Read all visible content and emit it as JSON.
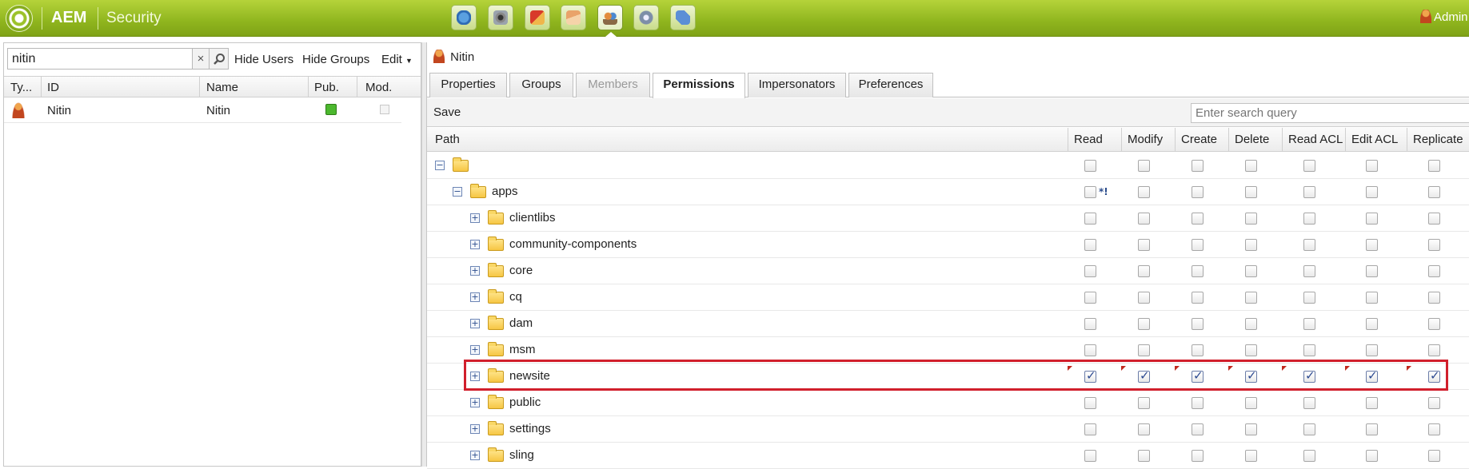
{
  "topbar": {
    "brand": "AEM",
    "section": "Security",
    "tools": [
      "websites-icon",
      "digital-assets-icon",
      "campaigns-icon",
      "inbox-icon",
      "users-icon",
      "tools-icon",
      "tagging-icon"
    ],
    "active_tool": "users-icon",
    "user": "Admin"
  },
  "left": {
    "search_value": "nitin",
    "clear": "×",
    "hide_users": "Hide Users",
    "hide_groups": "Hide Groups",
    "edit": "Edit",
    "columns": [
      "Ty...",
      "ID",
      "Name",
      "Pub.",
      "Mod."
    ],
    "rows": [
      {
        "id": "Nitin",
        "name": "Nitin",
        "published": true,
        "modified": false
      }
    ]
  },
  "right": {
    "title": "Nitin",
    "tabs": [
      {
        "label": "Properties",
        "state": "normal"
      },
      {
        "label": "Groups",
        "state": "normal"
      },
      {
        "label": "Members",
        "state": "disabled"
      },
      {
        "label": "Permissions",
        "state": "active"
      },
      {
        "label": "Impersonators",
        "state": "normal"
      },
      {
        "label": "Preferences",
        "state": "normal"
      }
    ],
    "save": "Save",
    "query_placeholder": "Enter search query",
    "columns": {
      "path": "Path",
      "read": "Read",
      "modify": "Modify",
      "create": "Create",
      "delete": "Delete",
      "read_acl": "Read ACL",
      "edit_acl": "Edit ACL",
      "replicate": "Replicate"
    },
    "rows": [
      {
        "name": "",
        "level": 0,
        "expander": "−",
        "perms": [
          false,
          false,
          false,
          false,
          false,
          false,
          false
        ]
      },
      {
        "name": "apps",
        "level": 1,
        "expander": "−",
        "perms": [
          false,
          false,
          false,
          false,
          false,
          false,
          false
        ],
        "effective_note": "*!"
      },
      {
        "name": "clientlibs",
        "level": 2,
        "expander": "+",
        "perms": [
          false,
          false,
          false,
          false,
          false,
          false,
          false
        ]
      },
      {
        "name": "community-components",
        "level": 2,
        "expander": "+",
        "perms": [
          false,
          false,
          false,
          false,
          false,
          false,
          false
        ]
      },
      {
        "name": "core",
        "level": 2,
        "expander": "+",
        "perms": [
          false,
          false,
          false,
          false,
          false,
          false,
          false
        ]
      },
      {
        "name": "cq",
        "level": 2,
        "expander": "+",
        "perms": [
          false,
          false,
          false,
          false,
          false,
          false,
          false
        ]
      },
      {
        "name": "dam",
        "level": 2,
        "expander": "+",
        "perms": [
          false,
          false,
          false,
          false,
          false,
          false,
          false
        ]
      },
      {
        "name": "msm",
        "level": 2,
        "expander": "+",
        "perms": [
          false,
          false,
          false,
          false,
          false,
          false,
          false
        ]
      },
      {
        "name": "newsite",
        "level": 2,
        "expander": "+",
        "perms": [
          true,
          true,
          true,
          true,
          true,
          true,
          true
        ],
        "dirty": true,
        "highlighted": true
      },
      {
        "name": "public",
        "level": 2,
        "expander": "+",
        "perms": [
          false,
          false,
          false,
          false,
          false,
          false,
          false
        ]
      },
      {
        "name": "settings",
        "level": 2,
        "expander": "+",
        "perms": [
          false,
          false,
          false,
          false,
          false,
          false,
          false
        ]
      },
      {
        "name": "sling",
        "level": 2,
        "expander": "+",
        "perms": [
          false,
          false,
          false,
          false,
          false,
          false,
          false
        ]
      }
    ]
  },
  "colors": {
    "topbar": "#8fb51e",
    "highlight": "#d11f2c",
    "published": "#4cb82e",
    "dirty_marker": "#c0281e"
  }
}
